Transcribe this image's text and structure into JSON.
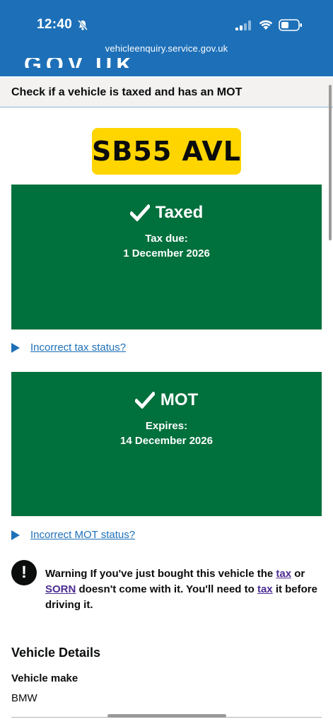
{
  "status_bar": {
    "time": "12:40"
  },
  "browser": {
    "url": "vehicleenquiry.service.gov.uk"
  },
  "header": {
    "logo_text": "GOV.UK"
  },
  "service": {
    "title": "Check if a vehicle is taxed and has an MOT"
  },
  "vehicle": {
    "registration": "SB55 AVL"
  },
  "tax_panel": {
    "status": "Taxed",
    "label": "Tax due:",
    "date": "1 December 2026"
  },
  "tax_details": {
    "link": "Incorrect tax status?"
  },
  "mot_panel": {
    "status": "MOT",
    "label": "Expires:",
    "date": "14 December 2026"
  },
  "mot_details": {
    "link": "Incorrect MOT status?"
  },
  "warning": {
    "prefix": "Warning If you've just bought this vehicle the",
    "link_tax_1": "tax",
    "or": "or",
    "link_sorn": "SORN",
    "middle": "doesn't come with it. You'll need to",
    "link_tax_2": "tax",
    "suffix": "it before driving it."
  },
  "vehicle_details": {
    "heading": "Vehicle Details",
    "make_label": "Vehicle make",
    "make_value": "BMW"
  },
  "colors": {
    "header_blue": "#1d70b8",
    "panel_green": "#00703c",
    "plate_yellow": "#ffd500",
    "visited_link": "#4c2c92"
  }
}
